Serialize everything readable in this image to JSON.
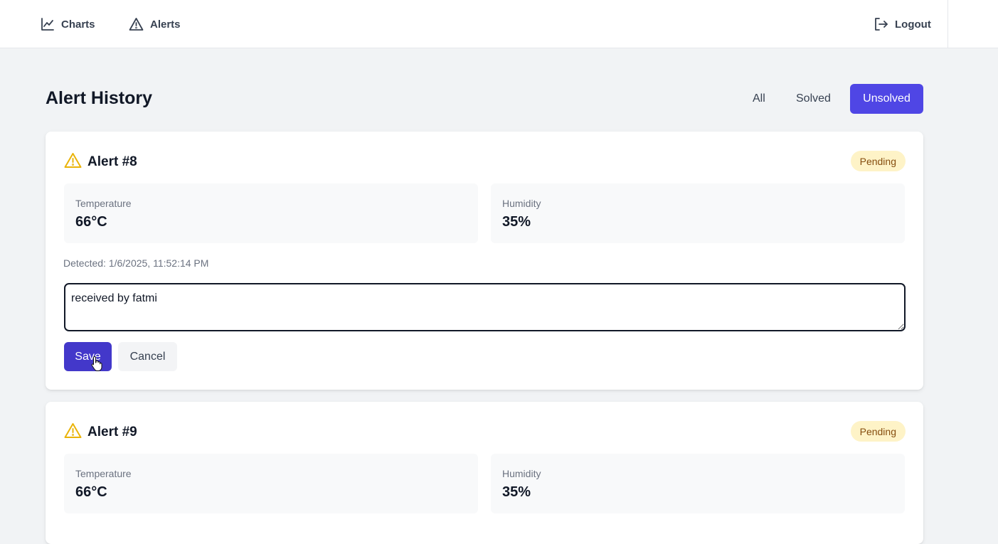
{
  "nav": {
    "charts_label": "Charts",
    "alerts_label": "Alerts",
    "logout_label": "Logout"
  },
  "page": {
    "title": "Alert History"
  },
  "filters": {
    "all": "All",
    "solved": "Solved",
    "unsolved": "Unsolved",
    "active": "Unsolved"
  },
  "alerts": [
    {
      "title": "Alert #8",
      "status": "Pending",
      "temperature_label": "Temperature",
      "temperature_value": "66°C",
      "humidity_label": "Humidity",
      "humidity_value": "35%",
      "detected": "Detected: 1/6/2025, 11:52:14 PM",
      "note_value": "received by fatmi",
      "save_label": "Save",
      "cancel_label": "Cancel"
    },
    {
      "title": "Alert #9",
      "status": "Pending",
      "temperature_label": "Temperature",
      "temperature_value": "66°C",
      "humidity_label": "Humidity",
      "humidity_value": "35%"
    }
  ],
  "colors": {
    "accent": "#4f46e5",
    "accent_dark": "#4338ca",
    "warning_icon": "#eab308",
    "pending_bg": "#fef3c7",
    "pending_text": "#854d0e",
    "page_bg": "#f1f3f5"
  },
  "icons": {
    "charts": "line-chart-icon",
    "alerts": "warning-triangle-icon",
    "logout": "logout-icon",
    "alert": "warning-triangle-icon"
  }
}
